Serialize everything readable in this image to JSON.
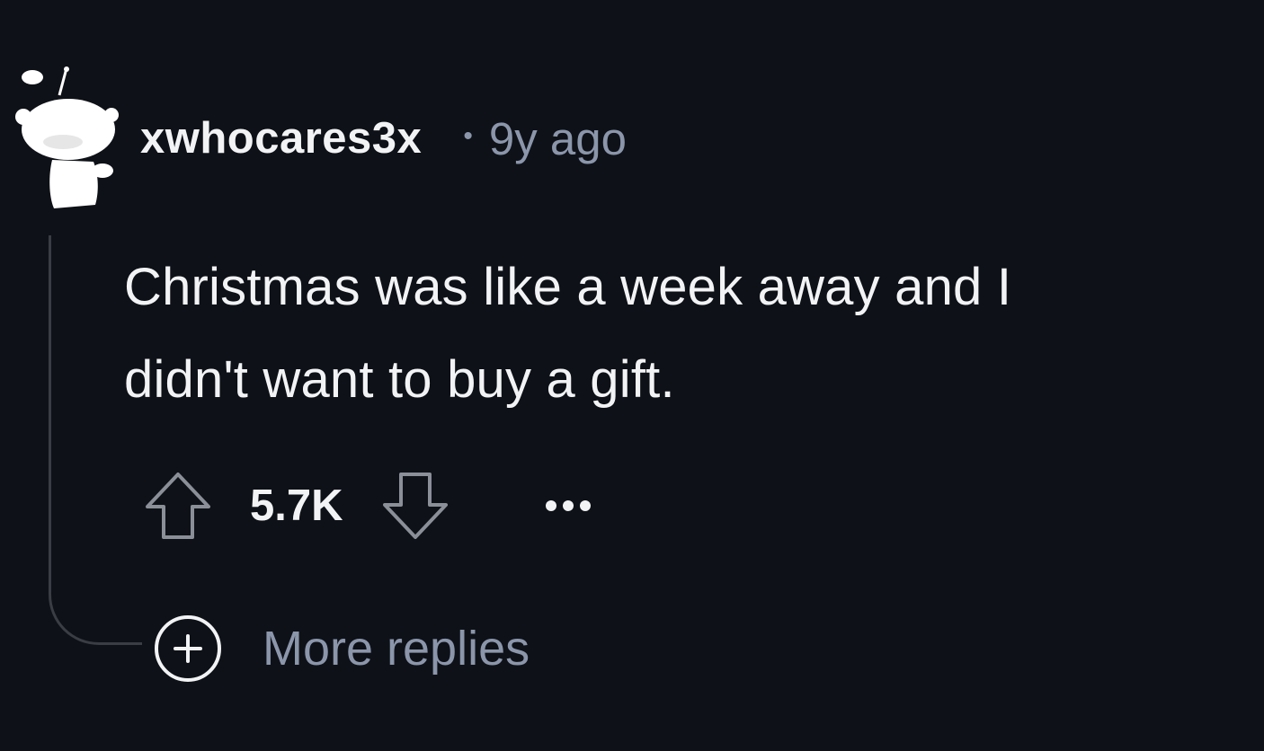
{
  "comment": {
    "author": "xwhocares3x",
    "separator": "•",
    "timestamp": "9y ago",
    "body_line_1": "Christmas was like a week away and I",
    "body_line_2": "didn't want to buy a gift.",
    "score": "5.7K",
    "more_icon_name": "more-options-icon",
    "upvote_icon_name": "upvote-arrow-icon",
    "downvote_icon_name": "downvote-arrow-icon"
  },
  "thread": {
    "more_replies_label": "More replies",
    "expand_icon_name": "plus-circle-icon"
  },
  "colors": {
    "background": "#0e1117",
    "text_primary": "#f2f3f5",
    "text_secondary": "#8b96ab",
    "thread_line": "#3a3d44"
  }
}
